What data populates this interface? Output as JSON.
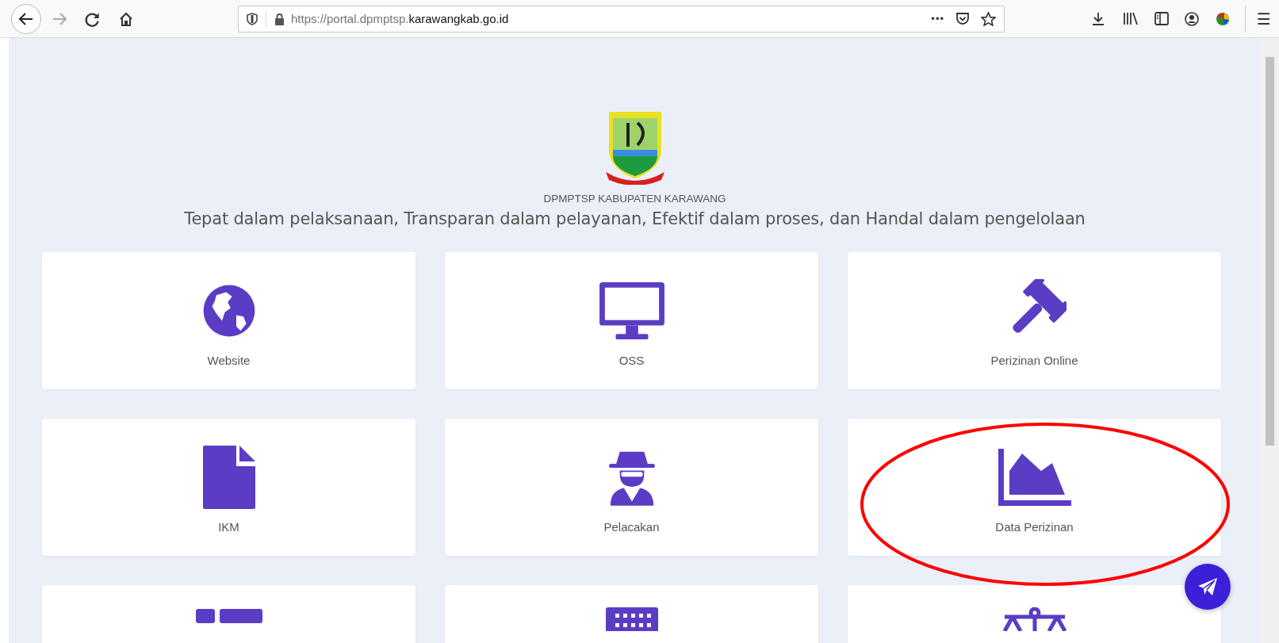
{
  "browser": {
    "url_host_prefix": "https://portal.dpmptsp.",
    "url_domain": "karawangkab.go.id",
    "more_button": "•••",
    "menu_button": "☰"
  },
  "header": {
    "agency": "DPMPTSP KABUPATEN KARAWANG",
    "tagline": "Tepat dalam pelaksanaan, Transparan dalam pelayanan, Efektif dalam proses, dan Handal dalam pengelolaan"
  },
  "cards": [
    {
      "label": "Website"
    },
    {
      "label": "OSS"
    },
    {
      "label": "Perizinan Online"
    },
    {
      "label": "IKM"
    },
    {
      "label": "Pelacakan"
    },
    {
      "label": "Data Perizinan",
      "highlighted": true
    }
  ]
}
